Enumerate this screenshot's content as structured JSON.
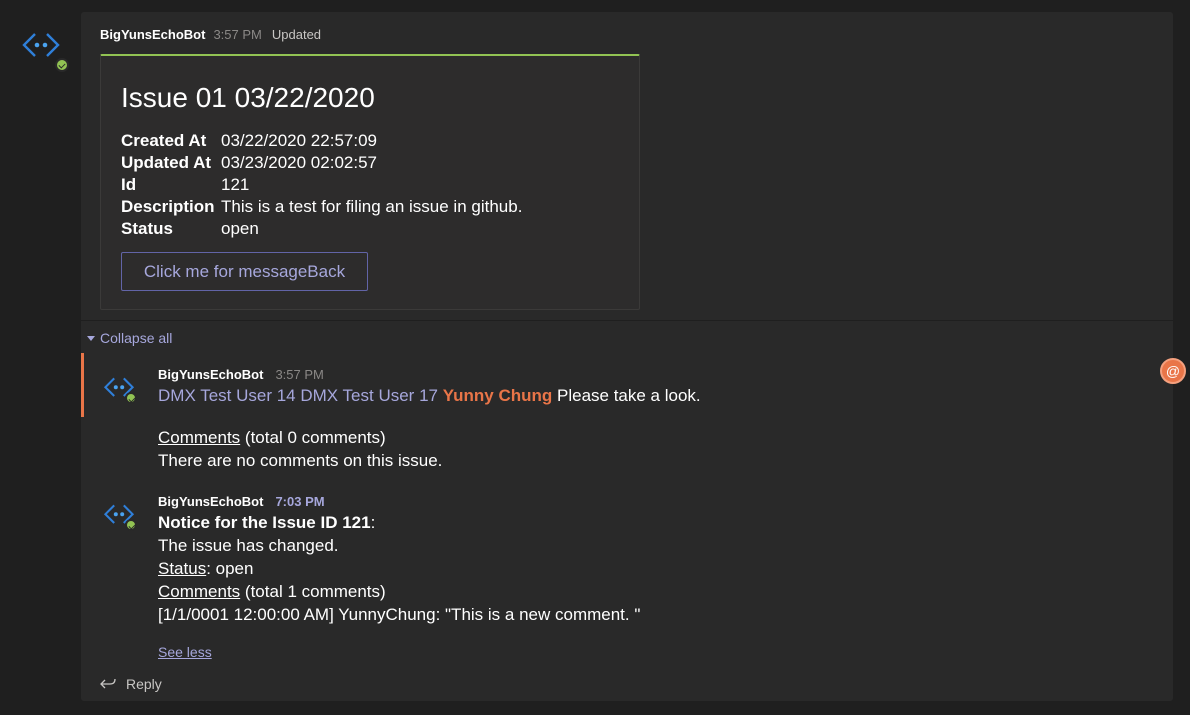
{
  "colors": {
    "background": "#1f1f1f",
    "thread": "#292929",
    "card": "#2d2c2c",
    "accent": "#92c353",
    "brand": "#6264a7",
    "link": "#a6a7dc",
    "mention": "#e97548"
  },
  "top_message": {
    "sender": "BigYunsEchoBot",
    "time": "3:57 PM",
    "status": "Updated",
    "avatar_icon": "bot-icon",
    "card": {
      "title": "Issue 01 03/22/2020",
      "facts": [
        {
          "key": "Created At",
          "value": "03/22/2020 22:57:09"
        },
        {
          "key": "Updated At",
          "value": "03/23/2020 02:02:57"
        },
        {
          "key": "Id",
          "value": "121"
        },
        {
          "key": "Description",
          "value": "This is a test for filing an issue in github."
        },
        {
          "key": "Status",
          "value": "open"
        }
      ],
      "button_label": "Click me for messageBack"
    }
  },
  "collapse_label": "Collapse all",
  "reply1": {
    "sender": "BigYunsEchoBot",
    "time": "3:57 PM",
    "mentions": [
      "DMX Test User 14",
      "DMX Test User 17"
    ],
    "mention_me": "Yunny Chung",
    "text_after_mentions": "Please take a look.",
    "comments_link": "Comments",
    "comments_count": "(total 0 comments)",
    "no_comments": "There are no comments on this issue."
  },
  "reply2": {
    "sender": "BigYunsEchoBot",
    "time": "7:03 PM",
    "notice_bold": "Notice for the Issue ID 121",
    "notice_colon": ":",
    "changed": "The issue has changed.",
    "status_link": "Status",
    "status_value": ": open",
    "comments_link": "Comments",
    "comments_count": "(total 1 comments)",
    "comment_entry": "[1/1/0001 12:00:00 AM] YunnyChung: \"This is a new comment. \"",
    "see_less": "See less"
  },
  "reply_label": "Reply",
  "at_badge": "@"
}
